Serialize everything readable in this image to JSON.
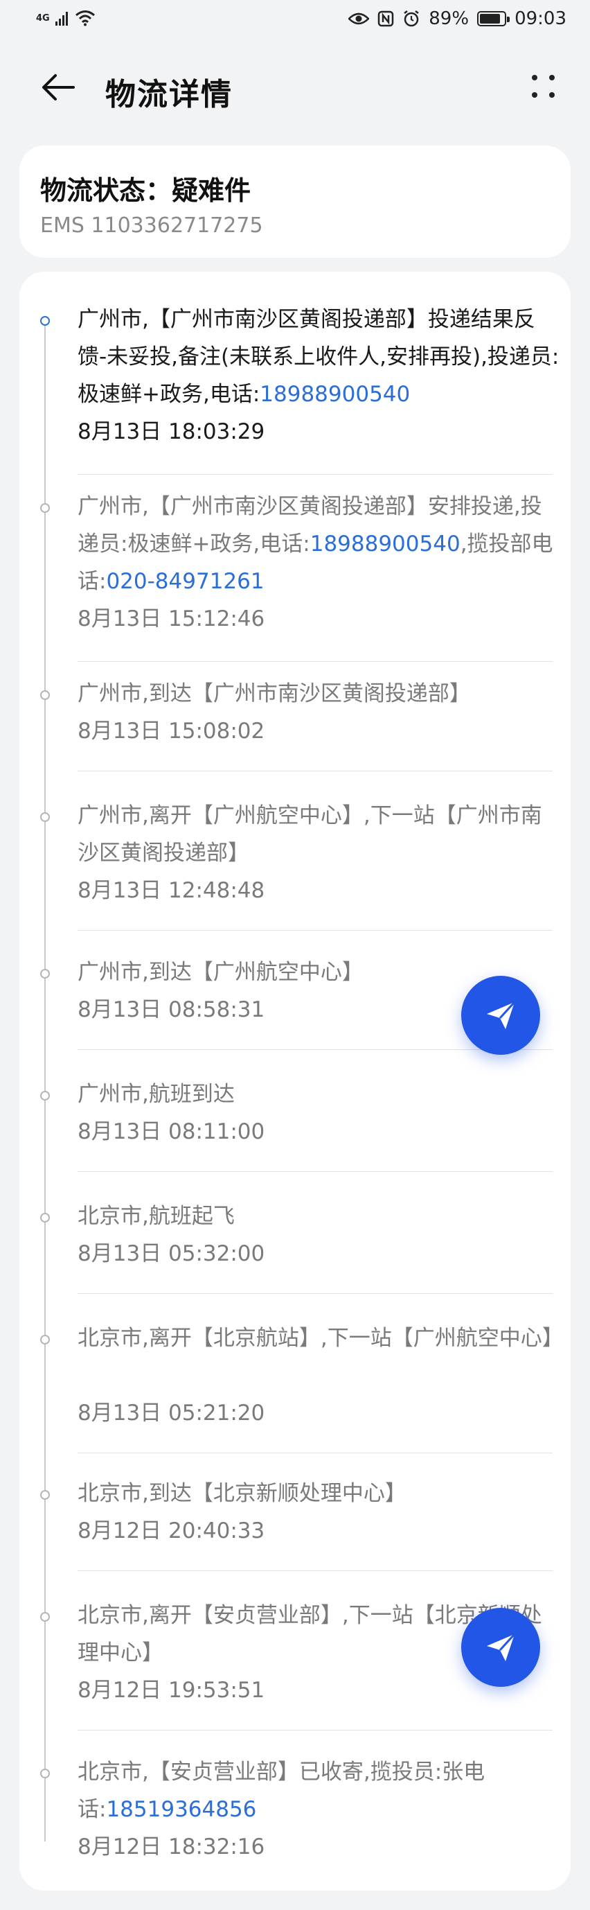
{
  "status_bar": {
    "network": "4G",
    "battery": "89%",
    "time": "09:03",
    "battery_level": 0.89
  },
  "header": {
    "title": "物流详情"
  },
  "status_card": {
    "status_line": "物流状态：疑难件",
    "tracking": "EMS 1103362717275"
  },
  "events": [
    {
      "parts": [
        "广州市,【广州市南沙区黄阁投递部】投递结果反馈-未妥投,备注(未联系上收件人,安排再投),投递员:极速鲜+政务,电话:"
      ],
      "phone1": "18988900540",
      "between": "",
      "phone2": "",
      "time": "8月13日 18:03:29"
    },
    {
      "parts": [
        "广州市,【广州市南沙区黄阁投递部】安排投递,投递员:极速鲜+政务,电话:"
      ],
      "phone1": "18988900540",
      "between": ",揽投部电话:",
      "phone2": "020-84971261",
      "time": "8月13日 15:12:46"
    },
    {
      "parts": [
        "广州市,到达【广州市南沙区黄阁投递部】"
      ],
      "time": "8月13日 15:08:02"
    },
    {
      "parts": [
        "广州市,离开【广州航空中心】,下一站【广州市南沙区黄阁投递部】"
      ],
      "time": "8月13日 12:48:48"
    },
    {
      "parts": [
        "广州市,到达【广州航空中心】"
      ],
      "time": "8月13日 08:58:31"
    },
    {
      "parts": [
        "广州市,航班到达"
      ],
      "time": "8月13日 08:11:00"
    },
    {
      "parts": [
        "北京市,航班起飞"
      ],
      "time": "8月13日 05:32:00"
    },
    {
      "parts": [
        "北京市,离开【北京航站】,下一站【广州航空中心】"
      ],
      "time": "8月13日 05:21:20"
    },
    {
      "parts": [
        "北京市,到达【北京新顺处理中心】"
      ],
      "time": "8月12日 20:40:33"
    },
    {
      "parts": [
        "北京市,离开【安贞营业部】,下一站【北京新顺处理中心】"
      ],
      "time": "8月12日 19:53:51"
    },
    {
      "parts": [
        "北京市,【安贞营业部】已收寄,揽投员:张电话:"
      ],
      "phone1": "18519364856",
      "between": "",
      "phone2": "",
      "time": "8月12日 18:32:16"
    }
  ],
  "icons": {
    "back": "back-arrow-icon",
    "more": "more-grid-icon",
    "fab": "send-icon"
  },
  "colors": {
    "accent": "#2156e6",
    "link": "#2b6ed6"
  }
}
